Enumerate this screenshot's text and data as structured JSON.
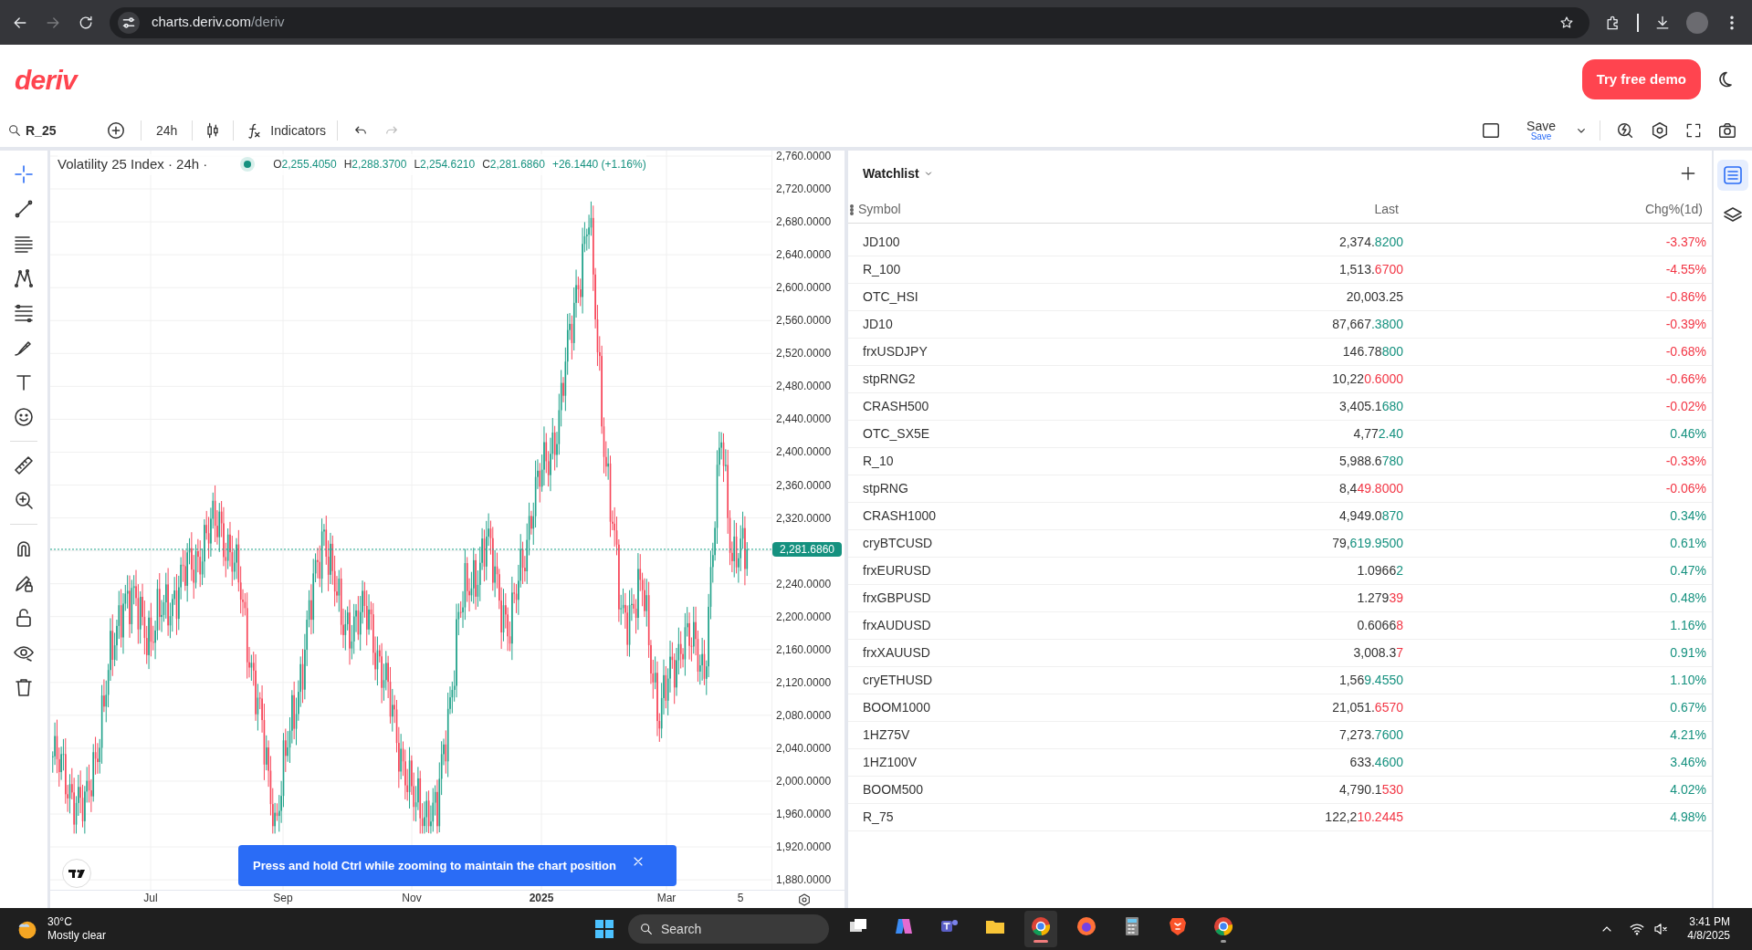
{
  "browser": {
    "url_host": "charts.deriv.com",
    "url_path": "/deriv",
    "forward_disabled": true
  },
  "header": {
    "logo": "deriv",
    "cta": "Try free demo"
  },
  "toolbar": {
    "symbol": "R_25",
    "interval": "24h",
    "indicators": "Indicators",
    "undo_disabled": false,
    "redo_disabled": true,
    "save": "Save",
    "save_sub": "Save"
  },
  "drawing_tools": [
    {
      "kind": "crosshair",
      "selected": true
    },
    {
      "kind": "line",
      "selected": false
    },
    {
      "kind": "channels",
      "selected": false
    },
    {
      "kind": "pattern",
      "selected": false
    },
    {
      "kind": "fib",
      "selected": false
    },
    {
      "kind": "brush",
      "selected": false
    },
    {
      "kind": "text",
      "selected": false
    },
    {
      "kind": "emoji",
      "selected": false
    },
    {
      "kind": "ruler",
      "selected": false
    },
    {
      "kind": "zoom",
      "selected": false
    },
    {
      "kind": "magnet",
      "selected": false
    },
    {
      "kind": "lock-draw",
      "selected": false
    },
    {
      "kind": "lock",
      "selected": false
    },
    {
      "kind": "eye",
      "selected": false
    },
    {
      "kind": "trash",
      "selected": false
    }
  ],
  "chart": {
    "legend": {
      "title": "Volatility 25 Index · 24h ·",
      "ohlc": [
        {
          "label": "O",
          "value": "2,255.4050"
        },
        {
          "label": "H",
          "value": "2,288.3700"
        },
        {
          "label": "L",
          "value": "2,254.6210"
        },
        {
          "label": "C",
          "value": "2,281.6860"
        }
      ],
      "change": "+26.1440 (+1.16%)"
    },
    "price_ticks": [
      "2,760.0000",
      "2,720.0000",
      "2,680.0000",
      "2,640.0000",
      "2,600.0000",
      "2,560.0000",
      "2,520.0000",
      "2,480.0000",
      "2,440.0000",
      "2,400.0000",
      "2,360.0000",
      "2,320.0000",
      "2,240.0000",
      "2,200.0000",
      "2,160.0000",
      "2,120.0000",
      "2,080.0000",
      "2,040.0000",
      "2,000.0000",
      "1,960.0000",
      "1,920.0000",
      "1,880.0000"
    ],
    "current_price": "2,281.6860",
    "time_labels": [
      {
        "text": "Jul",
        "kind": "month"
      },
      {
        "text": "Sep",
        "kind": "month"
      },
      {
        "text": "Nov",
        "kind": "month"
      },
      {
        "text": "2025",
        "kind": "year"
      },
      {
        "text": "Mar",
        "kind": "month"
      },
      {
        "text": "5",
        "kind": "day"
      }
    ],
    "toast": "Press and hold Ctrl while zooming to maintain the chart position"
  },
  "watchlist": {
    "title": "Watchlist",
    "columns": [
      "Symbol",
      "Last",
      "Chg%(1d)"
    ],
    "rows": [
      {
        "symbol": "JD100",
        "last": {
          "fixed": "2,374.",
          "changed": "8200",
          "color": "#15917f"
        },
        "change": {
          "text": "-3.37%",
          "color": "#f23645"
        }
      },
      {
        "symbol": "R_100",
        "last": {
          "fixed": "1,513.",
          "changed": "6700",
          "color": "#f23645"
        },
        "change": {
          "text": "-4.55%",
          "color": "#f23645"
        }
      },
      {
        "symbol": "OTC_HSI",
        "last": {
          "fixed": "20,003.25"
        },
        "change": {
          "text": "-0.86%",
          "color": "#f23645"
        }
      },
      {
        "symbol": "JD10",
        "last": {
          "fixed": "87,667",
          "changed": ".3800",
          "color": "#15917f"
        },
        "change": {
          "text": "-0.39%",
          "color": "#f23645"
        }
      },
      {
        "symbol": "frxUSDJPY",
        "last": {
          "fixed": "146.78",
          "changed": "800",
          "color": "#15917f"
        },
        "change": {
          "text": "-0.68%",
          "color": "#f23645"
        }
      },
      {
        "symbol": "stpRNG2",
        "last": {
          "fixed": "10,22",
          "changed": "0.6000",
          "color": "#f23645"
        },
        "change": {
          "text": "-0.66%",
          "color": "#f23645"
        }
      },
      {
        "symbol": "CRASH500",
        "last": {
          "fixed": "3,405.1",
          "changed": "680",
          "color": "#15917f"
        },
        "change": {
          "text": "-0.02%",
          "color": "#f23645"
        }
      },
      {
        "symbol": "OTC_SX5E",
        "last": {
          "fixed": "4,77",
          "changed": "2.40",
          "color": "#15917f"
        },
        "change": {
          "text": "0.46%",
          "color": "#15917f"
        }
      },
      {
        "symbol": "R_10",
        "last": {
          "fixed": "5,988.6",
          "changed": "780",
          "color": "#15917f"
        },
        "change": {
          "text": "-0.33%",
          "color": "#f23645"
        }
      },
      {
        "symbol": "stpRNG",
        "last": {
          "fixed": "8,4",
          "changed": "49.8000",
          "color": "#f23645"
        },
        "change": {
          "text": "-0.06%",
          "color": "#f23645"
        }
      },
      {
        "symbol": "CRASH1000",
        "last": {
          "fixed": "4,949.0",
          "changed": "870",
          "color": "#15917f"
        },
        "change": {
          "text": "0.34%",
          "color": "#15917f"
        }
      },
      {
        "symbol": "cryBTCUSD",
        "last": {
          "fixed": "79,",
          "changed": "619.9500",
          "color": "#15917f"
        },
        "change": {
          "text": "0.61%",
          "color": "#15917f"
        }
      },
      {
        "symbol": "frxEURUSD",
        "last": {
          "fixed": "1.0966",
          "changed": "2",
          "color": "#15917f"
        },
        "change": {
          "text": "0.47%",
          "color": "#15917f"
        }
      },
      {
        "symbol": "frxGBPUSD",
        "last": {
          "fixed": "1.279",
          "changed": "39",
          "color": "#f23645"
        },
        "change": {
          "text": "0.48%",
          "color": "#15917f"
        }
      },
      {
        "symbol": "frxAUDUSD",
        "last": {
          "fixed": "0.6066",
          "changed": "8",
          "color": "#f23645"
        },
        "change": {
          "text": "1.16%",
          "color": "#15917f"
        }
      },
      {
        "symbol": "frxXAUUSD",
        "last": {
          "fixed": "3,008.3",
          "changed": "7",
          "color": "#f23645"
        },
        "change": {
          "text": "0.91%",
          "color": "#15917f"
        }
      },
      {
        "symbol": "cryETHUSD",
        "last": {
          "fixed": "1,56",
          "changed": "9.4550",
          "color": "#15917f"
        },
        "change": {
          "text": "1.10%",
          "color": "#15917f"
        }
      },
      {
        "symbol": "BOOM1000",
        "last": {
          "fixed": "21,051.",
          "changed": "6570",
          "color": "#f23645"
        },
        "change": {
          "text": "0.67%",
          "color": "#15917f"
        }
      },
      {
        "symbol": "1HZ75V",
        "last": {
          "fixed": "7,273.",
          "changed": "7600",
          "color": "#15917f"
        },
        "change": {
          "text": "4.21%",
          "color": "#15917f"
        }
      },
      {
        "symbol": "1HZ100V",
        "last": {
          "fixed": "633.",
          "changed": "4600",
          "color": "#15917f"
        },
        "change": {
          "text": "3.46%",
          "color": "#15917f"
        }
      },
      {
        "symbol": "BOOM500",
        "last": {
          "fixed": "4,790.1",
          "changed": "530",
          "color": "#f23645"
        },
        "change": {
          "text": "4.02%",
          "color": "#15917f"
        }
      },
      {
        "symbol": "R_75",
        "last": {
          "fixed": "122,2",
          "changed": "10.2445",
          "color": "#f23645"
        },
        "change": {
          "text": "4.98%",
          "color": "#15917f"
        }
      }
    ]
  },
  "side_panel": [
    {
      "kind": "watchlist",
      "selected": true
    },
    {
      "kind": "layers",
      "selected": false
    }
  ],
  "taskbar": {
    "weather": {
      "temp": "30°C",
      "text": "Mostly clear"
    },
    "search": {
      "placeholder": "Search"
    },
    "apps": [
      {
        "kind": "task-view",
        "active": false,
        "running": false
      },
      {
        "kind": "copilot",
        "active": false,
        "running": false
      },
      {
        "kind": "teams",
        "active": false,
        "running": false
      },
      {
        "kind": "folder",
        "active": false,
        "running": false
      },
      {
        "kind": "chrome",
        "active": true,
        "running": true
      },
      {
        "kind": "firefox",
        "active": false,
        "running": false
      },
      {
        "kind": "calculator",
        "active": false,
        "running": false
      },
      {
        "kind": "brave",
        "active": false,
        "running": false
      },
      {
        "kind": "chrome",
        "active": false,
        "running": true
      }
    ],
    "time": "3:41 PM",
    "date": "4/8/2025"
  }
}
